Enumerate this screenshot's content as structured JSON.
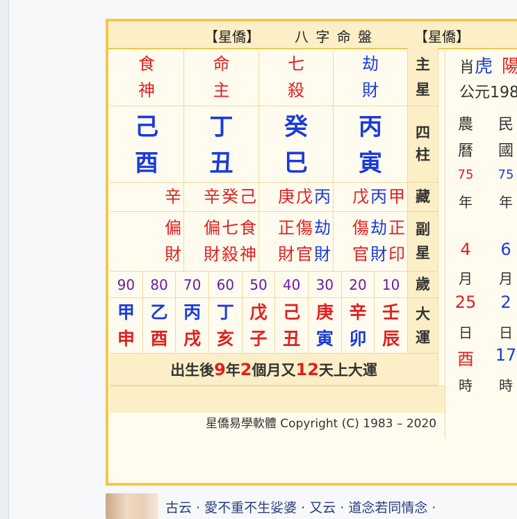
{
  "title": {
    "left": "【星僑】",
    "center": "八 字 命 盤",
    "right": "【星僑】"
  },
  "main_star_label": [
    "主",
    "星"
  ],
  "pillar_label": [
    "四",
    "柱"
  ],
  "hidden_label": "藏",
  "sub_star_label": [
    "副",
    "星"
  ],
  "age_label": "歲",
  "luck_label": [
    "大",
    "運"
  ],
  "stars": [
    {
      "a": "食",
      "b": "神",
      "color": "#e02020"
    },
    {
      "a": "命",
      "b": "主",
      "color": "#e02020"
    },
    {
      "a": "七",
      "b": "殺",
      "color": "#e02020"
    },
    {
      "a": "劫",
      "b": "財",
      "color": "#1b3bdc"
    }
  ],
  "pillars": [
    {
      "stem": "己",
      "branch": "酉"
    },
    {
      "stem": "丁",
      "branch": "丑"
    },
    {
      "stem": "癸",
      "branch": "巳"
    },
    {
      "stem": "丙",
      "branch": "寅"
    }
  ],
  "hidden": [
    [
      {
        "t": "辛",
        "c": "#e02020"
      }
    ],
    [
      {
        "t": "辛",
        "c": "#e02020"
      },
      {
        "t": "癸",
        "c": "#e02020"
      },
      {
        "t": "己",
        "c": "#e02020"
      }
    ],
    [
      {
        "t": "庚",
        "c": "#e02020"
      },
      {
        "t": "戊",
        "c": "#e02020"
      },
      {
        "t": "丙",
        "c": "#1b3bdc"
      }
    ],
    [
      {
        "t": "戊",
        "c": "#e02020"
      },
      {
        "t": "丙",
        "c": "#1b3bdc"
      },
      {
        "t": "甲",
        "c": "#e02020"
      }
    ]
  ],
  "sub": [
    [
      {
        "a": "偏",
        "b": "財",
        "c": "#e02020"
      }
    ],
    [
      {
        "a": "偏",
        "b": "財",
        "c": "#e02020"
      },
      {
        "a": "七",
        "b": "殺",
        "c": "#e02020"
      },
      {
        "a": "食",
        "b": "神",
        "c": "#e02020"
      }
    ],
    [
      {
        "a": "正",
        "b": "財",
        "c": "#e02020"
      },
      {
        "a": "傷",
        "b": "官",
        "c": "#e02020"
      },
      {
        "a": "劫",
        "b": "財",
        "c": "#1b3bdc"
      }
    ],
    [
      {
        "a": "傷",
        "b": "官",
        "c": "#e02020"
      },
      {
        "a": "劫",
        "b": "財",
        "c": "#1b3bdc"
      },
      {
        "a": "正",
        "b": "印",
        "c": "#e02020"
      }
    ]
  ],
  "ages": [
    "90",
    "80",
    "70",
    "60",
    "50",
    "40",
    "30",
    "20",
    "10"
  ],
  "luck": [
    {
      "stem": "甲",
      "stemc": "#1b3bdc",
      "branch": "申",
      "branchc": "#e02020"
    },
    {
      "stem": "乙",
      "stemc": "#1b3bdc",
      "branch": "酉",
      "branchc": "#e02020"
    },
    {
      "stem": "丙",
      "stemc": "#1b3bdc",
      "branch": "戌",
      "branchc": "#e02020"
    },
    {
      "stem": "丁",
      "stemc": "#1b3bdc",
      "branch": "亥",
      "branchc": "#e02020"
    },
    {
      "stem": "戊",
      "stemc": "#e02020",
      "branch": "子",
      "branchc": "#e02020"
    },
    {
      "stem": "己",
      "stemc": "#e02020",
      "branch": "丑",
      "branchc": "#e02020"
    },
    {
      "stem": "庚",
      "stemc": "#e02020",
      "branch": "寅",
      "branchc": "#1b3bdc"
    },
    {
      "stem": "辛",
      "stemc": "#e02020",
      "branch": "卯",
      "branchc": "#1b3bdc"
    },
    {
      "stem": "壬",
      "stemc": "#e02020",
      "branch": "辰",
      "branchc": "#e02020"
    }
  ],
  "start_luck": {
    "p1": "出生後",
    "n1": "9",
    "p2": "年",
    "n2": "2",
    "p3": "個月又",
    "n3": "12",
    "p4": "天上大運"
  },
  "zodiac": {
    "label": "肖",
    "value": "虎",
    "extra": "陽"
  },
  "gregorian_prefix": "公元198",
  "lunar": {
    "l1": "農",
    "l2": "曆",
    "year": "75",
    "year_unit": "年",
    "month": "4",
    "month_unit": "月",
    "day": "25",
    "day_unit": "日",
    "hour": "酉",
    "hour_unit": "時"
  },
  "minguo": {
    "l1": "民",
    "l2": "國",
    "year": "75",
    "year_unit": "年",
    "month": "6",
    "month_unit": "月",
    "day": "2",
    "day_unit": "日",
    "hour": "17",
    "hour_unit": "時"
  },
  "copyright": "星僑易學軟體 Copyright (C) 1983 – 2020",
  "quote": "古云 · 愛不重不生娑婆 · 又云 · 道念若同情念 ·"
}
